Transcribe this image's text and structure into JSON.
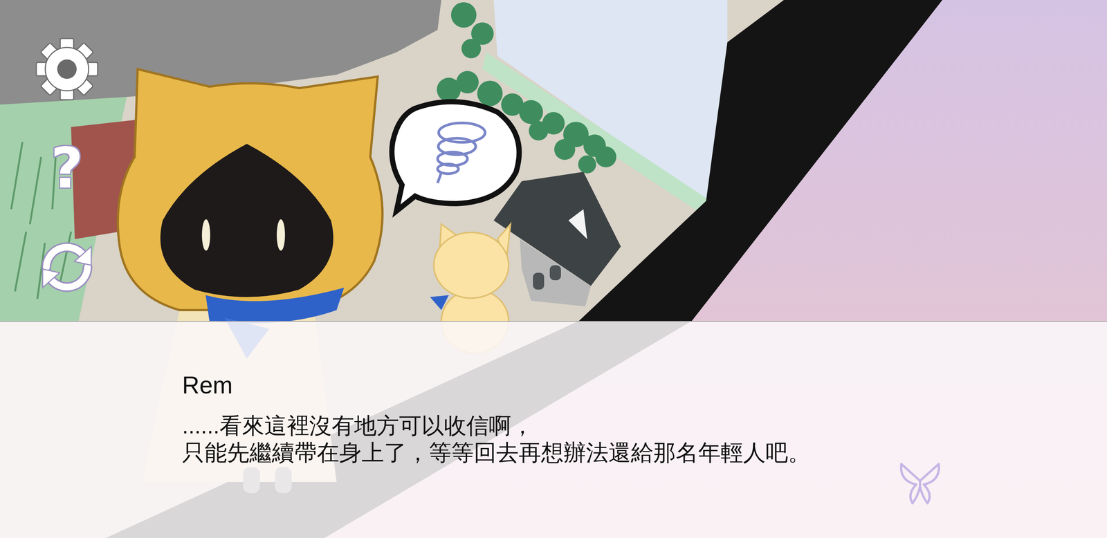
{
  "menu": {
    "help_label": "?"
  },
  "dialog": {
    "speaker": "Rem",
    "lines": [
      "......看來這裡沒有地方可以收信啊，",
      "只能先繼續帶在身上了，等等回去再想辦法還給那名年輕人吧。"
    ]
  }
}
